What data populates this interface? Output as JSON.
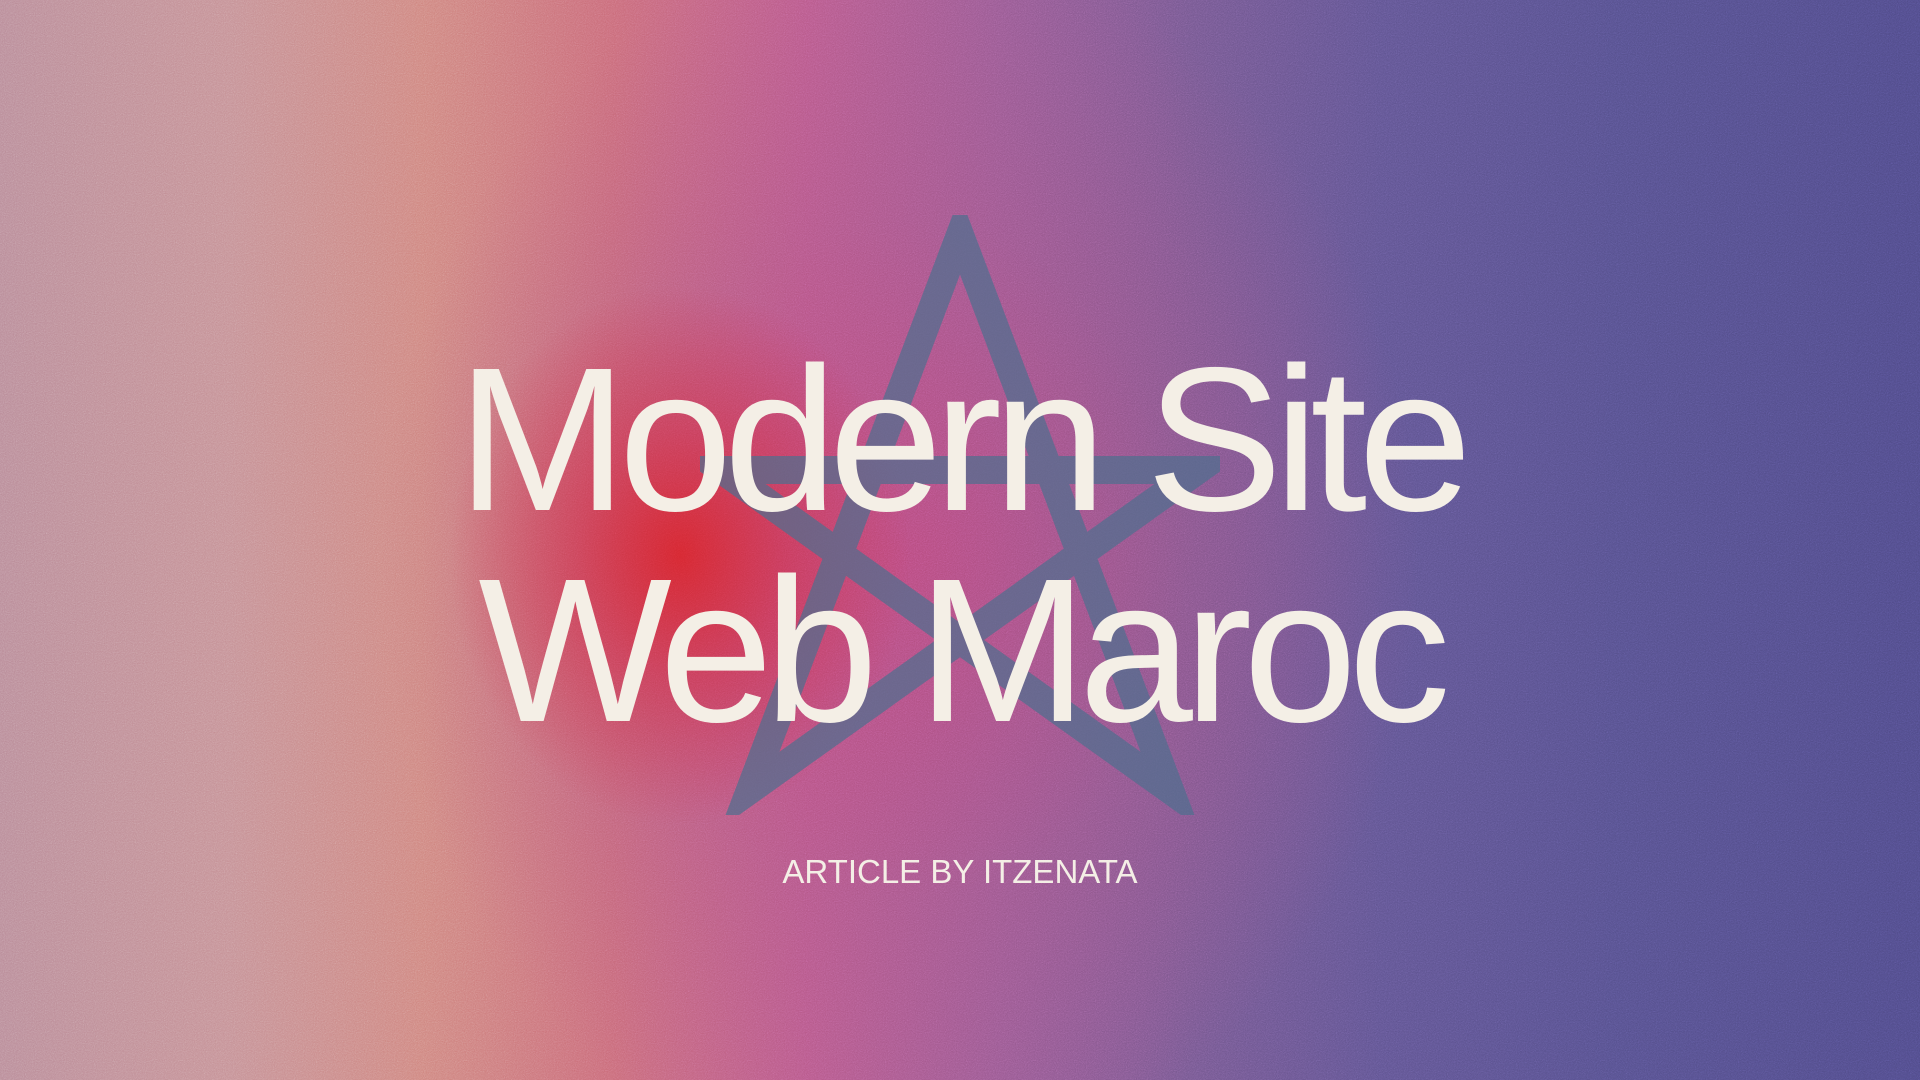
{
  "hero": {
    "title_line_1": "Modern Site",
    "title_line_2": "Web Maroc",
    "byline": "ARTICLE BY ITZENATA"
  },
  "emblem": {
    "icon": "pentagram-star-icon",
    "color": "#4f6f8f"
  },
  "colors": {
    "text": "#f4efe6",
    "left_tone": "#b98b98",
    "center_red": "#d6242c",
    "right_tone": "#4f4a88"
  }
}
